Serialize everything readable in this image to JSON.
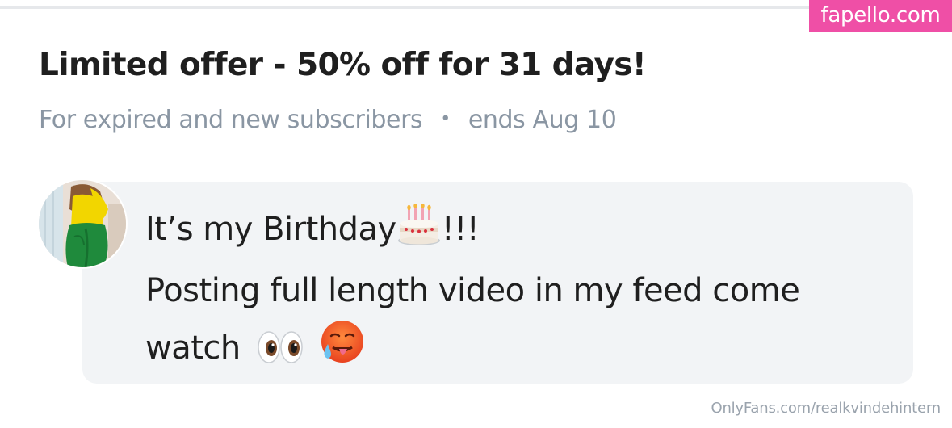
{
  "watermark": {
    "text": "fapello.com",
    "color": "#ef4fa6"
  },
  "offer": {
    "title": "Limited offer - 50% off for 31 days!",
    "subtitle_audience": "For expired and new subscribers",
    "subtitle_separator": "•",
    "subtitle_ends": "ends Aug 10"
  },
  "message": {
    "line1_text": "It’s my Birthday",
    "line1_suffix": "!!!",
    "line2": "Posting full length video in my feed come",
    "line3_text": "watch",
    "icons": [
      "birthday-cake-icon",
      "eyes-icon",
      "hot-face-icon"
    ]
  },
  "avatar": {
    "icon": "profile-photo"
  },
  "footer": {
    "credit": "OnlyFans.com/realkvindehintern"
  },
  "colors": {
    "title": "#1f1f1f",
    "muted": "#8a96a3",
    "bubble": "#f2f4f6"
  }
}
